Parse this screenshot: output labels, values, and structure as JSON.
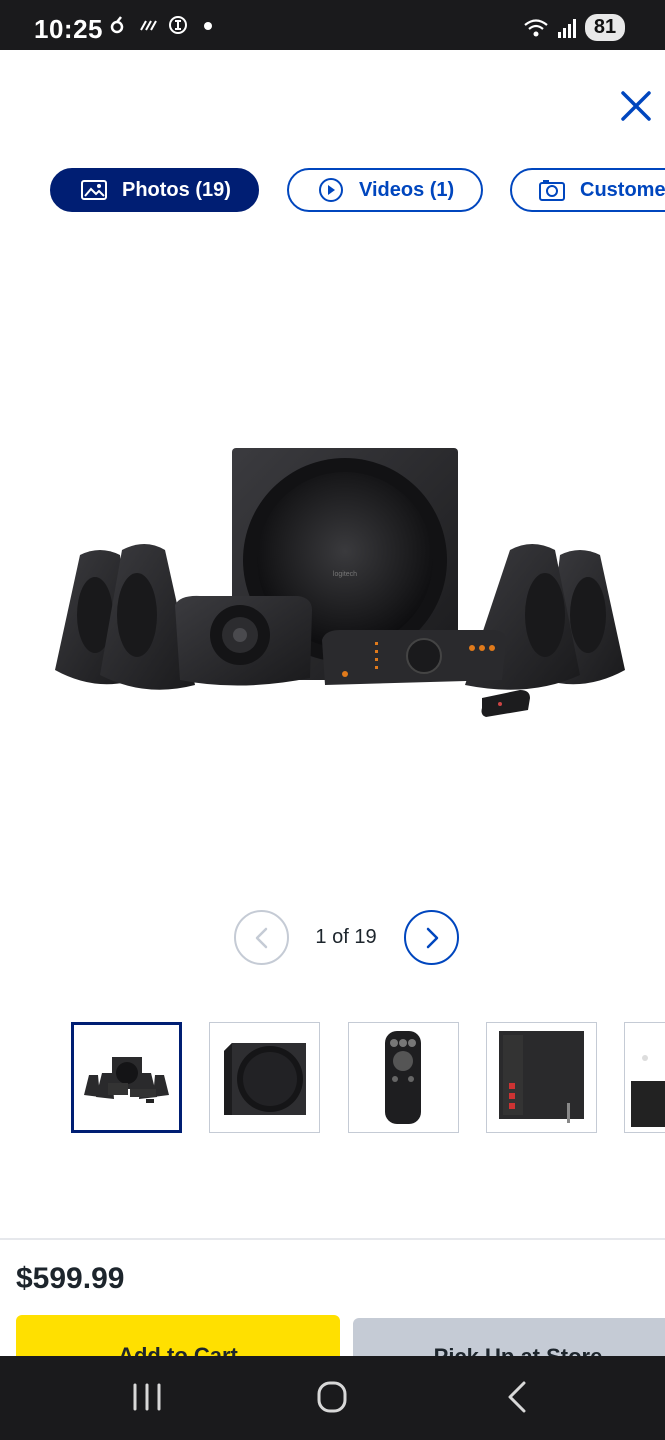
{
  "status_bar": {
    "time": "10:25",
    "battery": "81",
    "icons": [
      "notification-icon",
      "sync-icon",
      "alarm-icon",
      "dot-icon",
      "wifi-icon",
      "signal-icon"
    ]
  },
  "close": {
    "icon": "close-icon"
  },
  "tabs": [
    {
      "label": "Photos (19)",
      "icon": "image-icon",
      "active": true
    },
    {
      "label": "Videos (1)",
      "icon": "play-circle-icon",
      "active": false
    },
    {
      "label": "Customer",
      "icon": "camera-icon",
      "active": false
    }
  ],
  "pager": {
    "text": "1 of 19"
  },
  "thumbnails": [
    {
      "name": "speaker-system-thumb",
      "active": true
    },
    {
      "name": "subwoofer-thumb",
      "active": false
    },
    {
      "name": "remote-thumb",
      "active": false
    },
    {
      "name": "subwoofer-back-thumb",
      "active": false
    },
    {
      "name": "partial-thumb",
      "active": false
    }
  ],
  "purchase": {
    "price": "$599.99",
    "add_to_cart": "Add to Cart",
    "pick_up": "Pick Up at Store"
  },
  "colors": {
    "brand_blue": "#0046be",
    "active_tab": "#001e73",
    "cart_yellow": "#ffe000",
    "pickup_gray": "#c5cbd5"
  }
}
